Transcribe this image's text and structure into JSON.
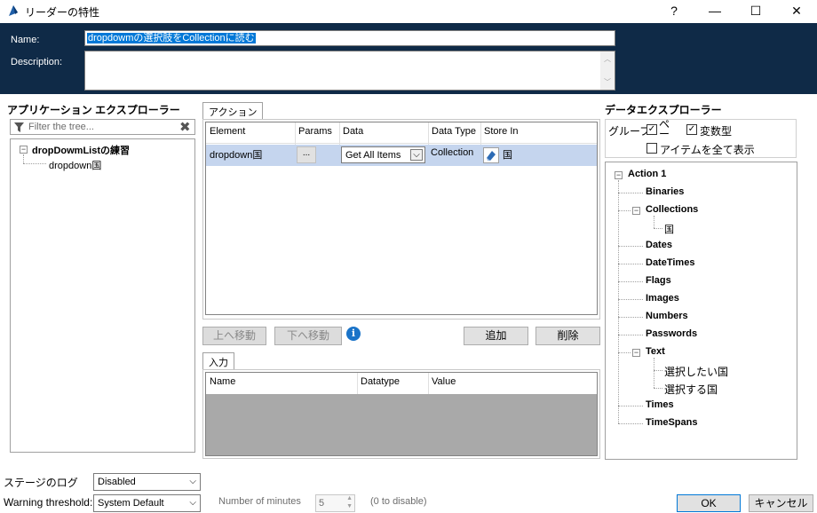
{
  "window": {
    "title": "リーダーの特性",
    "help_label": "?",
    "minimize_label": "—",
    "maximize_label": "☐",
    "close_label": "✕"
  },
  "header": {
    "name_label": "Name:",
    "name_value": "dropdowmの選択肢をCollectionに読む",
    "description_label": "Description:",
    "description_value": ""
  },
  "app_explorer": {
    "title": "アプリケーション エクスプローラー",
    "filter_placeholder": "Filter the tree...",
    "tree": [
      {
        "label": "dropDowmListの練習",
        "expanded": true
      },
      {
        "label": "dropdown国"
      }
    ]
  },
  "actions": {
    "tab_label": "アクション",
    "columns": [
      "Element",
      "Params",
      "Data",
      "Data Type",
      "Store In"
    ],
    "row": {
      "element": "dropdown国",
      "params_button": "...",
      "data": "Get All Items",
      "data_type": "Collection",
      "store_in": "国"
    },
    "move_up_label": "上へ移動",
    "move_down_label": "下へ移動",
    "info_icon_label": "i",
    "add_label": "追加",
    "delete_label": "削除"
  },
  "inputs": {
    "tab_label": "入力",
    "columns": [
      "Name",
      "Datatype",
      "Value"
    ]
  },
  "data_explorer": {
    "title": "データエクスプローラー",
    "group_label": "グループ",
    "group_page_label": "ページ",
    "group_var_label": "変数型",
    "show_all_label": "アイテムを全て表示",
    "group_page_checked": true,
    "group_var_checked": true,
    "show_all_checked": false,
    "tree": {
      "root": "Action 1",
      "binaries": "Binaries",
      "collections": "Collections",
      "collections_child": "国",
      "dates": "Dates",
      "datetimes": "DateTimes",
      "flags": "Flags",
      "images": "Images",
      "numbers": "Numbers",
      "passwords": "Passwords",
      "text": "Text",
      "text_child_1": "選択したい国",
      "text_child_2": "選択する国",
      "times": "Times",
      "timespans": "TimeSpans"
    }
  },
  "footer": {
    "stage_log_label": "ステージのログ",
    "stage_log_value": "Disabled",
    "warning_label": "Warning threshold:",
    "warning_value": "System Default",
    "minutes_label": "Number of minutes",
    "minutes_value": "5",
    "disable_hint": "(0 to disable)",
    "ok_label": "OK",
    "cancel_label": "キャンセル"
  },
  "colors": {
    "header_bg": "#0f2a47",
    "selection_row": "#c5d5ee",
    "grid_empty": "#a9a9a9",
    "info_icon": "#1a73c8"
  }
}
